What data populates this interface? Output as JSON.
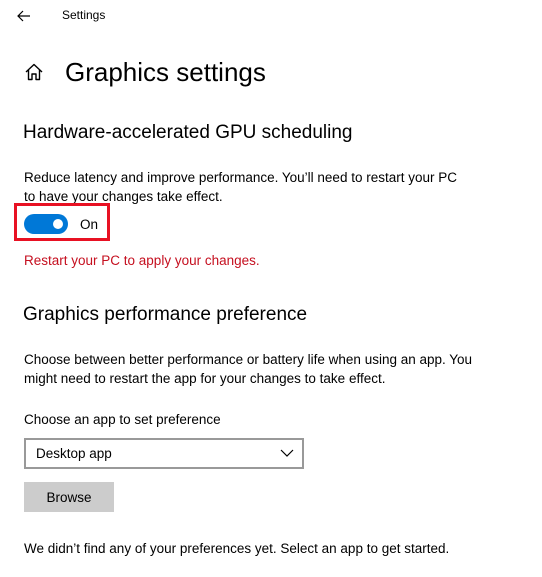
{
  "window": {
    "title": "Settings"
  },
  "header": {
    "title": "Graphics settings"
  },
  "gpu_scheduling": {
    "title": "Hardware-accelerated GPU scheduling",
    "description": "Reduce latency and improve performance. You’ll need to restart your PC to have your changes take effect.",
    "toggle_state": "On",
    "toggle_on": true,
    "restart_message": "Restart your PC to apply your changes."
  },
  "performance_preference": {
    "title": "Graphics performance preference",
    "description": "Choose between better performance or battery life when using an app. You might need to restart the app for your changes to take effect.",
    "choose_label": "Choose an app to set preference",
    "selected_app_type": "Desktop app",
    "browse_label": "Browse",
    "empty_message": "We didn’t find any of your preferences yet. Select an app to get started."
  },
  "colors": {
    "accent": "#0078d7",
    "error": "#c50f1f",
    "highlight_border": "#e81123",
    "button_bg": "#cccccc"
  },
  "icons": {
    "back": "back-arrow-icon",
    "home": "home-icon",
    "dropdown": "chevron-down-icon"
  }
}
